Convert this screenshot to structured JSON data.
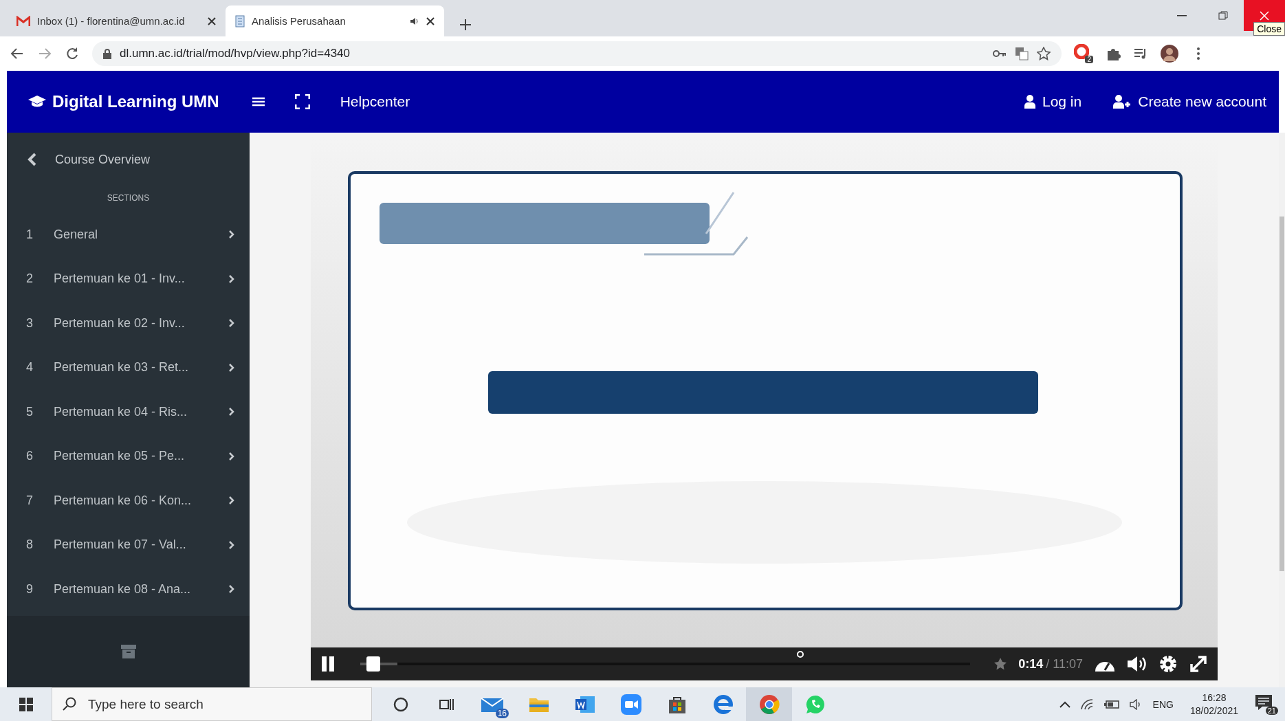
{
  "browser": {
    "tabs": [
      {
        "title": "Inbox (1) - florentina@umn.ac.id",
        "selected": false,
        "audio": false
      },
      {
        "title": "Analisis Perusahaan",
        "selected": true,
        "audio": true
      }
    ],
    "tooltip": "Close",
    "address": "dl.umn.ac.id/trial/mod/hvp/view.php?id=4340",
    "extension_badge": "2"
  },
  "header": {
    "brand": "Digital Learning UMN",
    "nav": "Helpcenter",
    "login": "Log in",
    "signup": "Create new account"
  },
  "sidebar": {
    "back": "Course Overview",
    "heading": "SECTIONS",
    "sections": [
      {
        "number": "1",
        "title": "General"
      },
      {
        "number": "2",
        "title": "Pertemuan ke 01 - Inv..."
      },
      {
        "number": "3",
        "title": "Pertemuan ke 02 - Inv..."
      },
      {
        "number": "4",
        "title": "Pertemuan ke 03 - Ret..."
      },
      {
        "number": "5",
        "title": "Pertemuan ke 04 - Ris..."
      },
      {
        "number": "6",
        "title": "Pertemuan ke 05 - Pe..."
      },
      {
        "number": "7",
        "title": "Pertemuan ke 06 - Kon..."
      },
      {
        "number": "8",
        "title": "Pertemuan ke 07 - Val..."
      },
      {
        "number": "9",
        "title": "Pertemuan ke 08 - Ana..."
      }
    ]
  },
  "player": {
    "playing": true,
    "level": 0.021,
    "current": "0:14",
    "total": "/ 11:07"
  },
  "taskbar": {
    "search_placeholder": "Type here to search",
    "mail_badge": "16",
    "language": "ENG",
    "time": "16:28",
    "date": "18/02/2021",
    "notifications": "21"
  }
}
